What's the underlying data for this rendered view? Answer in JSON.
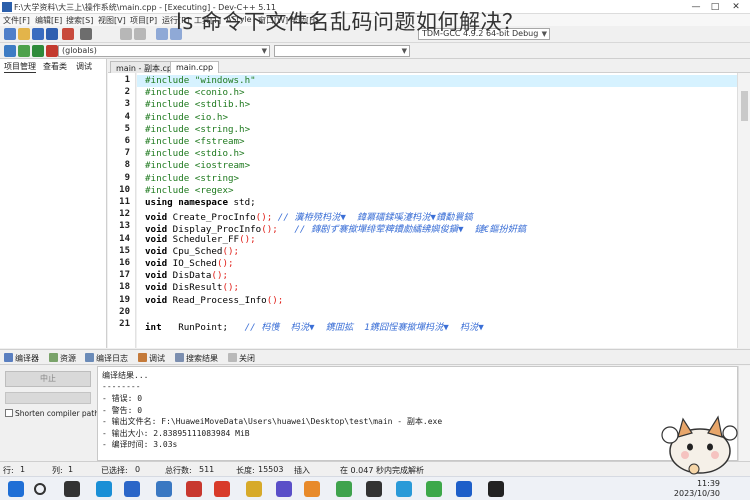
{
  "window": {
    "title": "F:\\大学资料\\大三上\\操作系统\\main.cpp - [Executing] - Dev-C++ 5.11",
    "controls": [
      "—",
      "□",
      "✕"
    ]
  },
  "overlay_title": "ls 命令下文件名乱码问题如何解决？",
  "menu": [
    "文件[F]",
    "编辑[E]",
    "搜索[S]",
    "视图[V]",
    "项目[P]",
    "运行[R]",
    "工具[T]",
    "AStyle",
    "窗口[W]",
    "帮助[H]"
  ],
  "toolbar": {
    "compiler_select": "TDM-GCC 4.9.2 64-bit Debug",
    "globals_select": "(globals)"
  },
  "left_panel": {
    "tabs": [
      "项目管理",
      "查看类",
      "调试"
    ]
  },
  "editor": {
    "tabs": [
      "main - 副本.cpp",
      "main.cpp"
    ],
    "active_tab": 1,
    "highlight_line": 1,
    "line_numbers": [
      "1",
      "2",
      "3",
      "4",
      "5",
      "6",
      "7",
      "8",
      "9",
      "10",
      "11",
      "12",
      "13",
      "14",
      "15",
      "16",
      "17",
      "18",
      "19",
      "20",
      "21"
    ],
    "lines": [
      {
        "pp": "#include \"windows.h\""
      },
      {
        "pp": "#include <conio.h>"
      },
      {
        "pp": "#include <stdlib.h>"
      },
      {
        "pp": "#include <io.h>"
      },
      {
        "pp": "#include <string.h>"
      },
      {
        "pp": "#include <fstream>"
      },
      {
        "pp": "#include <stdio.h>"
      },
      {
        "pp": "#include <iostream>"
      },
      {
        "pp": "#include <string>"
      },
      {
        "pp": "#include <regex>"
      },
      {
        "kw": "using namespace",
        "txt": " std;"
      },
      {
        "kw": "void",
        "txt": " Create_ProcInfo",
        "par": "();",
        "cmt": " // 瀵栫殑杩涚▼  鍏冪礌鍒嗘瀽杩涚▼鐨勫睘鎬"
      },
      {
        "kw": "void",
        "txt": " Display_ProcInfo",
        "par": "();",
        "cmt": "   // 鏄剧ず褰撳墠绯荤粺鐨勮繘绋嬩俊鎭▼  鏈€鏂扮姸鎬"
      },
      {
        "kw": "void",
        "txt": " Scheduler_FF",
        "par": "();"
      },
      {
        "kw": "void",
        "txt": " Cpu_Sched",
        "par": "();"
      },
      {
        "kw": "void",
        "txt": " IO_Sched",
        "par": "();"
      },
      {
        "kw": "void",
        "txt": " DisData",
        "par": "();"
      },
      {
        "kw": "void",
        "txt": " DisResult",
        "par": "();"
      },
      {
        "kw": "void",
        "txt": " Read_Process_Info",
        "par": "();"
      },
      {
        "txt": ""
      },
      {
        "kw": "int",
        "txt": "   RunPoint;",
        "cmt": "   // 杩愯  杩涚▼  鎸囬拡  1鎸囧悜褰撳墠杩涚▼  杩涚▼"
      }
    ]
  },
  "bottom_tabs": [
    "编译器",
    "资源",
    "编译日志",
    "调试",
    "搜索结果",
    "关闭"
  ],
  "bottom_left": {
    "stop_button": "中止",
    "shorten_label": "Shorten compiler paths"
  },
  "output": {
    "lines": [
      "编译结果...",
      "--------",
      "- 错误: 0",
      "- 警告: 0",
      "- 输出文件名: F:\\HuaweiMoveData\\Users\\huawei\\Desktop\\test\\main - 副本.exe",
      "- 输出大小: 2.83895111083984 MiB",
      "- 编译时间: 3.03s"
    ]
  },
  "status": {
    "row_label": "行:",
    "row_value": "1",
    "col_label": "列:",
    "col_value": "1",
    "sel_label": "已选择:",
    "sel_value": "0",
    "total_label": "总行数:",
    "total_value": "511",
    "len_label": "长度:",
    "len_value": "15503",
    "mode": "插入",
    "parse_msg": "在 0.047 秒内完成解析"
  },
  "taskbar": {
    "time": "11:39",
    "date": "2023/10/30"
  },
  "colors": {
    "highlight": "#d6f2ff",
    "preprocessor": "#1f7a1f",
    "comment": "#3b6fd6",
    "paren": "#e0201a"
  }
}
